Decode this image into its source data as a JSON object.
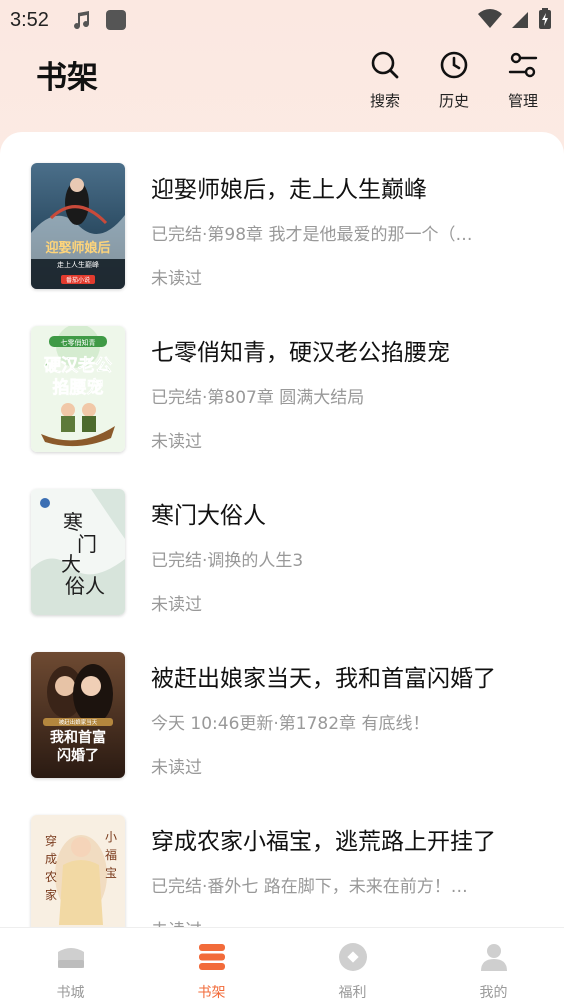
{
  "status_bar": {
    "time": "3:52"
  },
  "header": {
    "title": "书架",
    "actions": [
      {
        "label": "搜索",
        "icon": "search-icon"
      },
      {
        "label": "历史",
        "icon": "clock-icon"
      },
      {
        "label": "管理",
        "icon": "manage-icon"
      }
    ]
  },
  "books": [
    {
      "title": "迎娶师娘后，走上人生巅峰",
      "meta": "已完结·第98章 我才是他最爱的那一个（…",
      "status": "未读过"
    },
    {
      "title": "七零俏知青，硬汉老公掐腰宠",
      "meta": "已完结·第807章 圆满大结局",
      "status": "未读过"
    },
    {
      "title": "寒门大俗人",
      "meta": "已完结·调换的人生3",
      "status": "未读过"
    },
    {
      "title": "被赶出娘家当天，我和首富闪婚了",
      "meta": "今天 10:46更新·第1782章 有底线！",
      "status": "未读过"
    },
    {
      "title": "穿成农家小福宝，逃荒路上开挂了",
      "meta": "已完结·番外七 路在脚下，未来在前方！…",
      "status": "未读过"
    }
  ],
  "covers": [
    {
      "text": "迎娶师娘后",
      "sub": "走上人生巅峰",
      "badge": "番茄小说"
    },
    {
      "text": "硬汉老公掐腰宠",
      "badge": "七零俏知青"
    },
    {
      "text": "寒门大俗人"
    },
    {
      "text": "我和首富闪婚了",
      "badge": "被赶出娘家当天"
    },
    {
      "text": "穿成农家小福宝"
    }
  ],
  "bottom_nav": [
    {
      "label": "书城",
      "icon": "bookstore-icon",
      "active": false
    },
    {
      "label": "书架",
      "icon": "bookshelf-icon",
      "active": true
    },
    {
      "label": "福利",
      "icon": "welfare-icon",
      "active": false
    },
    {
      "label": "我的",
      "icon": "profile-icon",
      "active": false
    }
  ],
  "colors": {
    "accent": "#f26b3a",
    "muted": "#999999",
    "background": "#fdf0ea"
  }
}
